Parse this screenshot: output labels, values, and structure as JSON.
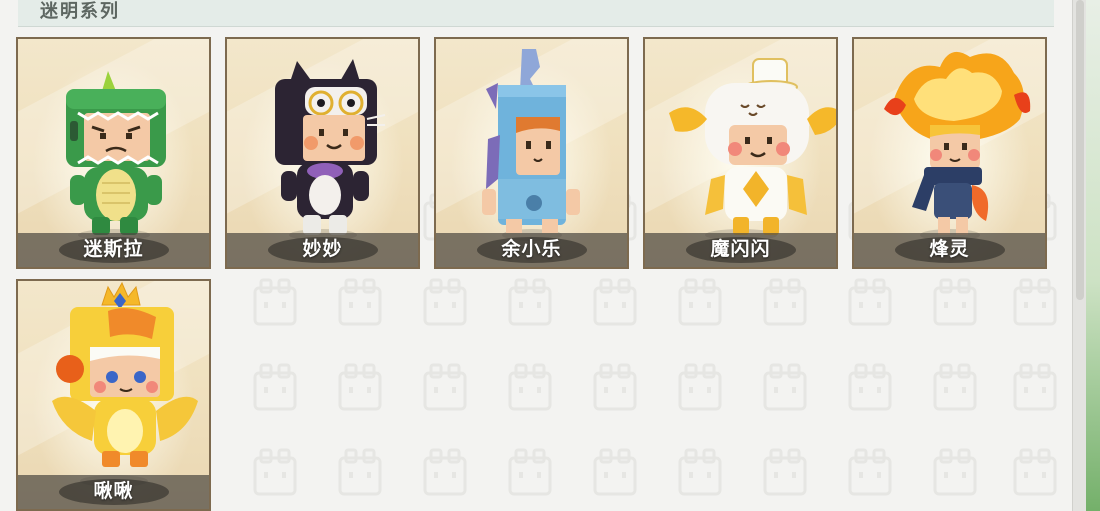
{
  "section": {
    "title": "迷明系列"
  },
  "skins": [
    {
      "name": "迷斯拉",
      "character": "green-dinosaur"
    },
    {
      "name": "妙妙",
      "character": "black-cat"
    },
    {
      "name": "余小乐",
      "character": "blue-fish-suit"
    },
    {
      "name": "魔闪闪",
      "character": "white-gold-angel"
    },
    {
      "name": "烽灵",
      "character": "fire-spirit"
    },
    {
      "name": "啾啾",
      "character": "yellow-bird"
    }
  ],
  "colors": {
    "card_border": "#7d6a4f",
    "card_bg": "#f0e1bf",
    "name_bar": "#4e4a42",
    "header_bg": "#e4ece8"
  }
}
